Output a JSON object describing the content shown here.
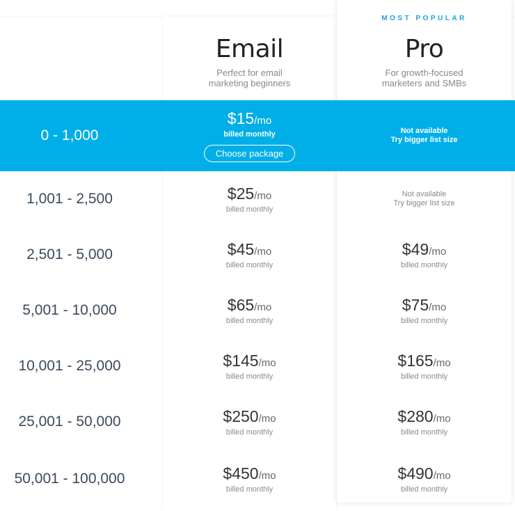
{
  "plans": [
    {
      "name": "Email",
      "description_line1": "Perfect for email",
      "description_line2": "marketing beginners"
    },
    {
      "name": "Pro",
      "badge": "MOST POPULAR",
      "description_line1": "For growth-focused",
      "description_line2": "marketers and SMBs"
    }
  ],
  "accent_color": "#00aee8",
  "selected": {
    "range": "0 - 1,000",
    "email_price": "$15",
    "unit": "/mo",
    "billed": "billed monthly",
    "choose_label": "Choose package",
    "pro_na1": "Not available",
    "pro_na2": "Try bigger list size"
  },
  "rows": [
    {
      "range": "1,001 - 2,500",
      "email": "$25",
      "pro": null,
      "pro_na1": "Not available",
      "pro_na2": "Try bigger list size"
    },
    {
      "range": "2,501 - 5,000",
      "email": "$45",
      "pro": "$49"
    },
    {
      "range": "5,001 - 10,000",
      "email": "$65",
      "pro": "$75"
    },
    {
      "range": "10,001 - 25,000",
      "email": "$145",
      "pro": "$165"
    },
    {
      "range": "25,001 - 50,000",
      "email": "$250",
      "pro": "$280"
    },
    {
      "range": "50,001 - 100,000",
      "email": "$450",
      "pro": "$490"
    }
  ],
  "unit": "/mo",
  "billed": "billed monthly"
}
